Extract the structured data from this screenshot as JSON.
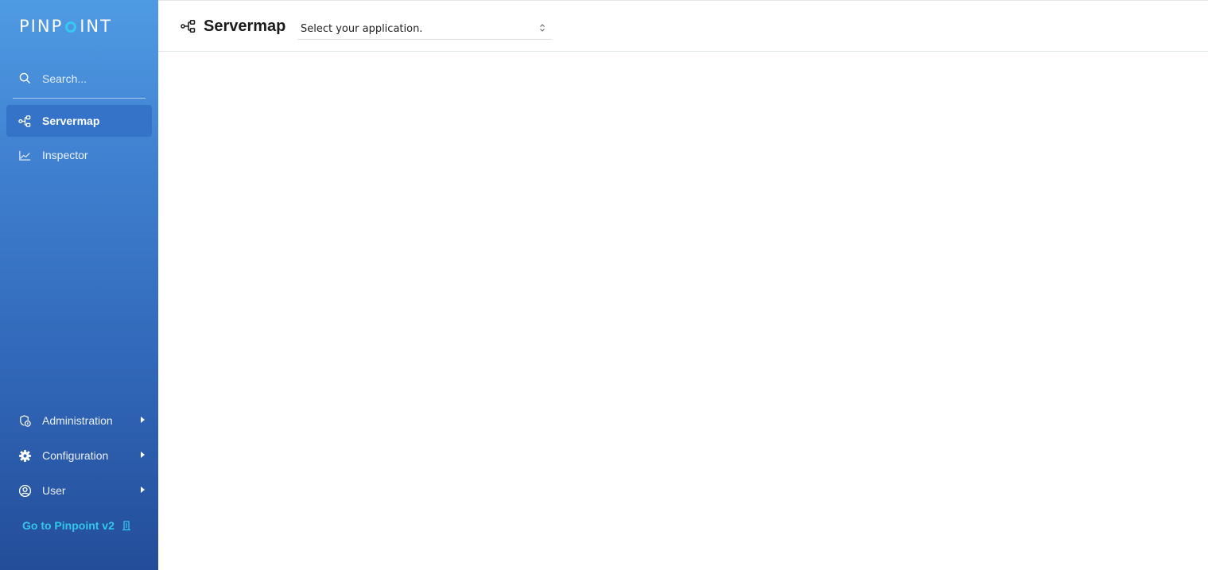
{
  "brand": {
    "logo_left": "PINP",
    "logo_right": "INT"
  },
  "search": {
    "placeholder": "Search..."
  },
  "nav": {
    "servermap": "Servermap",
    "inspector": "Inspector",
    "administration": "Administration",
    "configuration": "Configuration",
    "user": "User"
  },
  "goto_v2": "Go to Pinpoint v2",
  "header": {
    "title": "Servermap",
    "app_select": "Select your application."
  },
  "colors": {
    "sidebar_top": "#4f9be3",
    "sidebar_bottom": "#234d99",
    "active_item": "#3573c8",
    "accent": "#34c6ec"
  }
}
